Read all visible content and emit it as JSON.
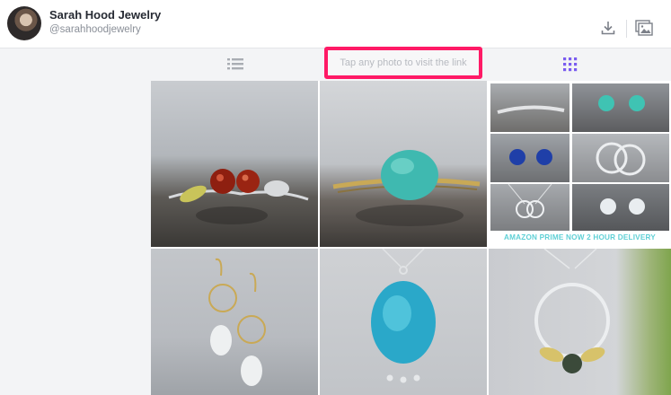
{
  "profile": {
    "name": "Sarah Hood Jewelry",
    "handle": "@sarahhoodjewelry"
  },
  "header": {
    "download_icon": "download-icon",
    "gallery_icon": "gallery-icon"
  },
  "toolbar": {
    "list_icon": "list-view-icon",
    "grid_icon": "grid-view-icon",
    "hint": "Tap any photo to visit the link"
  },
  "colors": {
    "accent": "#ff1a66",
    "grid_active": "#7a5cf0",
    "toolbar_bg": "#f3f4f6"
  },
  "grid": {
    "mosaic_caption": "AMAZON PRIME NOW 2 HOUR DELIVERY"
  }
}
